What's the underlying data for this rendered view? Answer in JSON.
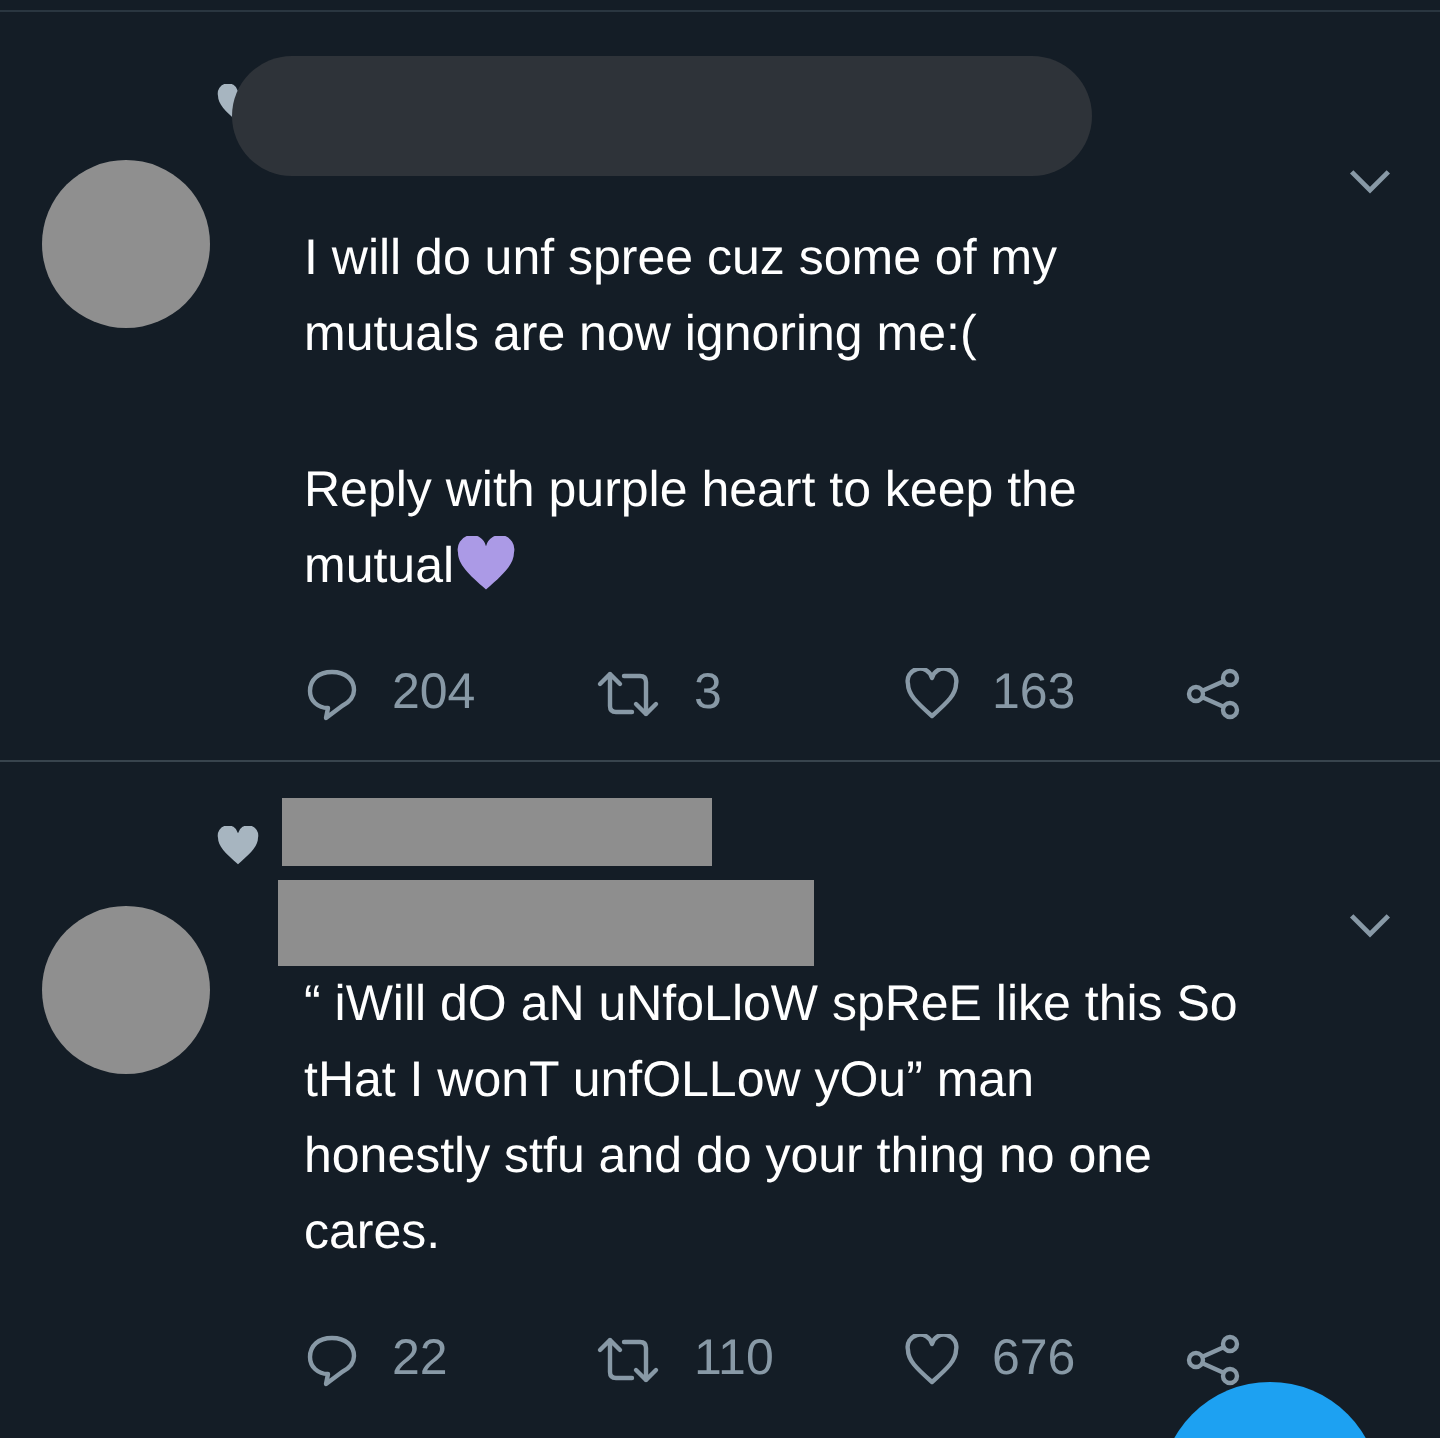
{
  "tweets": [
    {
      "kind": "pill",
      "text": [
        "I will do unf spree cuz some of my\nmutuals are now ignoring me:(",
        "Reply with purple heart to keep the\nmutual"
      ],
      "trailing_heart": true,
      "replies": "204",
      "retweets": "3",
      "likes": "163",
      "liked": false
    },
    {
      "kind": "bars",
      "text": [
        "“ iWill dO aN uNfoLloW spReE like this So\ntHat I wonT unfOLLow yOu” man\nhonestly stfu and do your thing no one\ncares."
      ],
      "trailing_heart": false,
      "replies": "22",
      "retweets": "110",
      "likes": "676",
      "liked": false
    }
  ]
}
